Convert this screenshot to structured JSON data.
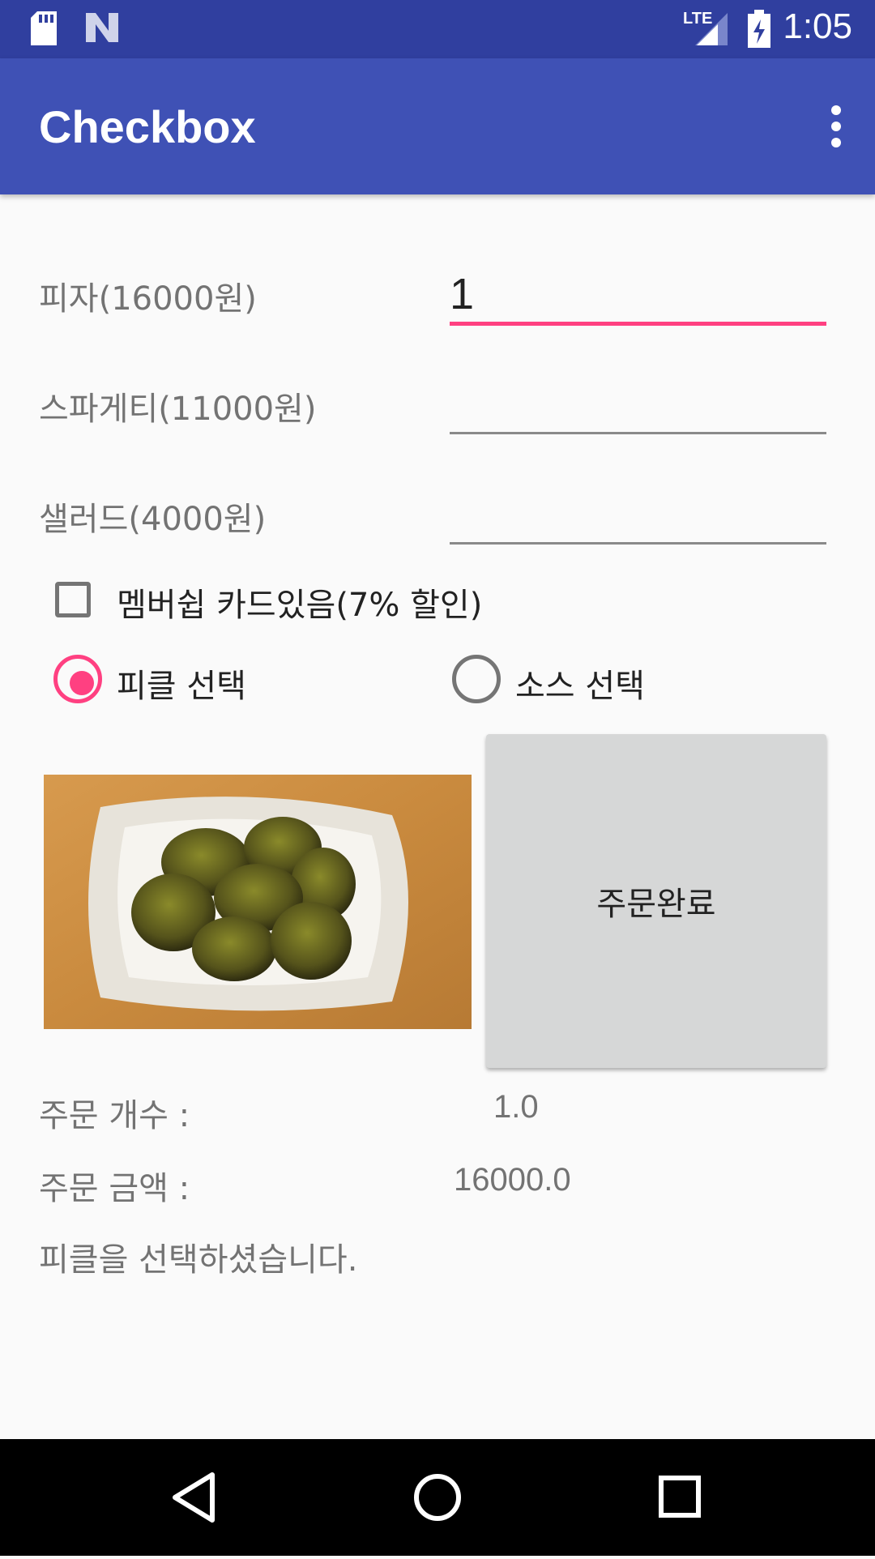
{
  "status_bar": {
    "time": "1:05",
    "network": "LTE"
  },
  "app_bar": {
    "title": "Checkbox"
  },
  "form": {
    "pizza_label": "피자(16000원)",
    "pizza_value": "1",
    "spaghetti_label": "스파게티(11000원)",
    "spaghetti_value": "",
    "salad_label": "샐러드(4000원)",
    "salad_value": ""
  },
  "membership": {
    "label": "멤버쉽 카드있음(7% 할인)",
    "checked": false
  },
  "options": {
    "pickle": {
      "label": "피클 선택",
      "checked": true
    },
    "sauce": {
      "label": "소스 선택",
      "checked": false
    }
  },
  "order_button": {
    "label": "주문완료"
  },
  "summary": {
    "count_label": "주문 개수 :",
    "count_value": "1.0",
    "amount_label": "주문 금액 :",
    "amount_value": "16000.0",
    "message": "피클을 선택하셨습니다."
  },
  "colors": {
    "primary": "#3f51b5",
    "primary_dark": "#303f9f",
    "accent": "#ff4081"
  }
}
